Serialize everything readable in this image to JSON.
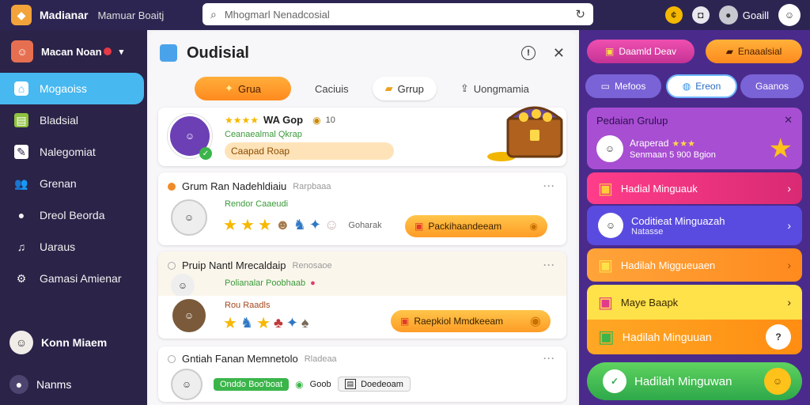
{
  "app": {
    "title": "Madianar",
    "subtitle": "Mamuar Boaitj"
  },
  "search": {
    "value": "Mhogmarl Nenadcosial"
  },
  "topbar": {
    "coin_label": "Goaill"
  },
  "sidebar": {
    "user": {
      "name": "Macan Noan"
    },
    "items": [
      {
        "label": "Mogaoiss",
        "icon": "home-icon"
      },
      {
        "label": "Bladsial",
        "icon": "book-icon"
      },
      {
        "label": "Nalegomiat",
        "icon": "edit-icon"
      },
      {
        "label": "Grenan",
        "icon": "people-icon"
      },
      {
        "label": "Dreol Beorda",
        "icon": "person-icon"
      },
      {
        "label": "Uaraus",
        "icon": "music-icon"
      },
      {
        "label": "Gamasi Amienar",
        "icon": "gear-icon"
      }
    ],
    "bottom_user": "Konn Miaem",
    "bottom_item": "Nanms"
  },
  "main": {
    "title": "Oudisial",
    "tabs": [
      {
        "label": "Grua"
      },
      {
        "label": "Caciuis"
      },
      {
        "label": "Grrup"
      },
      {
        "label": "Uongmamia"
      }
    ],
    "featured": {
      "title": "WA Gop",
      "count": "10",
      "subtitle": "Ceanaealmal Qkrap",
      "tag": "Caapad Roap"
    },
    "cards": [
      {
        "title": "Grum Ran Nadehldiaiu",
        "meta": "Rarpbaaa",
        "status": "Rendor Caaeudi",
        "reaction_label": "Goharak",
        "cta": "Packihaandeeam"
      },
      {
        "title": "Pruip Nantl Mrecaldaip",
        "meta": "Renosaoe",
        "sub_title": "Polianalar Poobhaab",
        "sub_meta": "Rou Raadls",
        "cta": "Raepkiol Mmdkeeam"
      },
      {
        "title": "Gntiah Fanan Memnetolo",
        "meta": "Rladeaa",
        "badge": "Onddo Boo'boat",
        "badge2": "Goob",
        "action": "Doedeoam"
      }
    ]
  },
  "right": {
    "top_buttons": [
      {
        "label": "Daamld Deav"
      },
      {
        "label": "Enaaalsial"
      }
    ],
    "filters": [
      {
        "label": "Mefoos"
      },
      {
        "label": "Ereon"
      },
      {
        "label": "Gaanos"
      }
    ],
    "promo": {
      "title": "Pedaian Grulup",
      "subtitle": "Araperad",
      "detail": "Senmaan 5 900 Bgion"
    },
    "items": [
      {
        "label": "Hadial Minguauk"
      },
      {
        "label": "Coditieat Minguazah",
        "sub": "Natasse"
      },
      {
        "label": "Hadilah Miggueuaen"
      },
      {
        "label": "Maye Baapk"
      },
      {
        "label": "Hadilah Minguuan"
      }
    ],
    "claim": {
      "label": "Hadilah Minguwan"
    }
  },
  "colors": {
    "sidebar": "#2b2348",
    "active": "#47b8f0",
    "accent": "#ff9c26",
    "right_panel": "#4a2b8c"
  }
}
